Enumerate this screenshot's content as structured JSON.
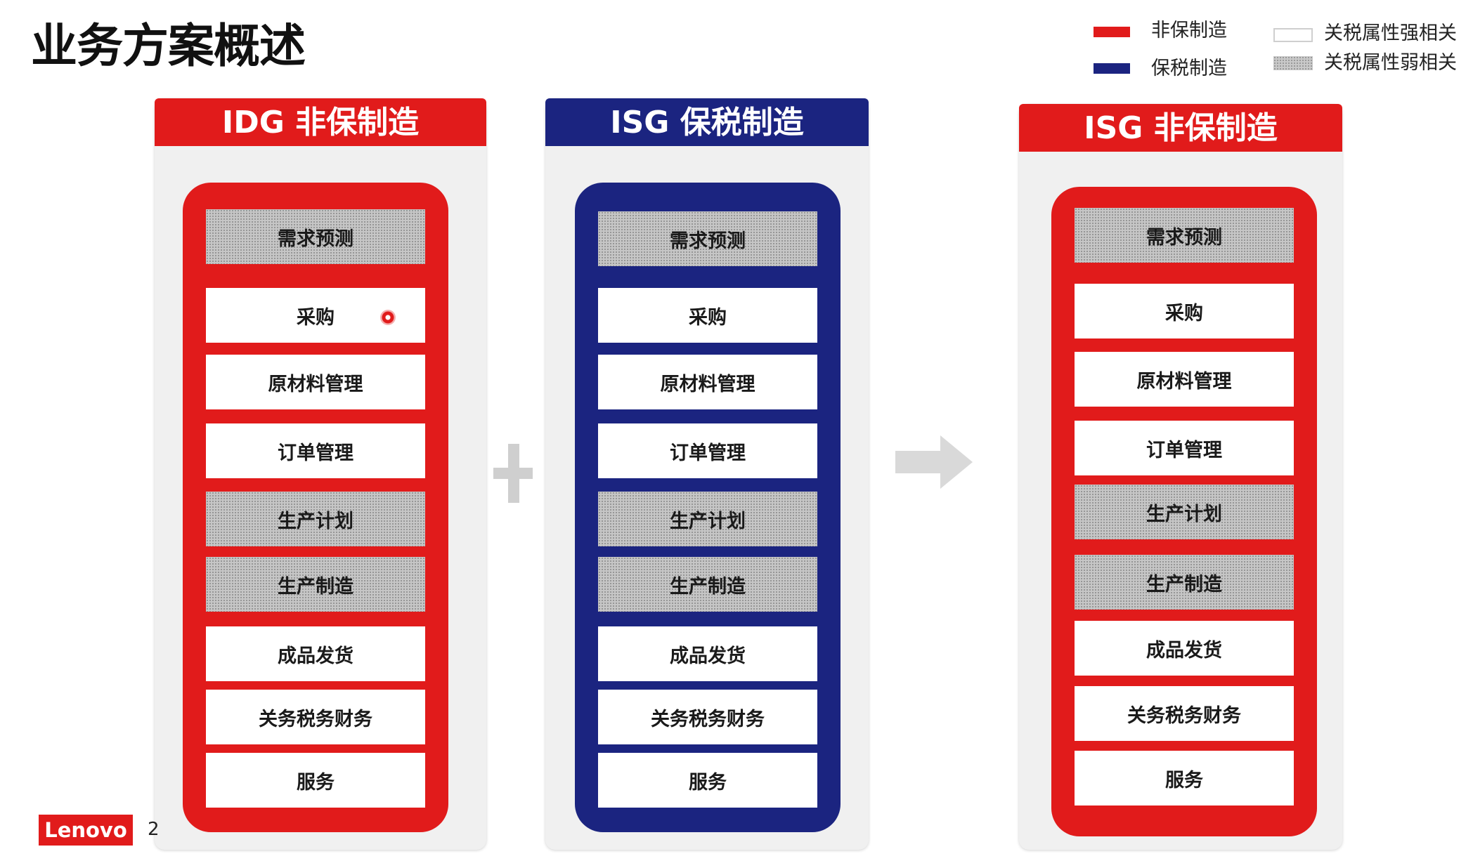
{
  "title": "业务方案概述",
  "colors": {
    "red": "#e11b1b",
    "navy": "#1b2480",
    "panel_bg": "#f0f0f0",
    "strong_fill": "#ffffff",
    "weak_fill": "dotted-gray"
  },
  "legend": {
    "items": [
      {
        "label": "非保制造",
        "swatch": "red"
      },
      {
        "label": "保税制造",
        "swatch": "navy"
      },
      {
        "label": "关税属性强相关",
        "swatch": "white-outline"
      },
      {
        "label": "关税属性弱相关",
        "swatch": "dotted-gray"
      }
    ]
  },
  "panels": [
    {
      "title": "IDG 非保制造",
      "color": "red",
      "steps": [
        {
          "label": "需求预测",
          "tariff": "weak"
        },
        {
          "label": "采购",
          "tariff": "strong"
        },
        {
          "label": "原材料管理",
          "tariff": "strong"
        },
        {
          "label": "订单管理",
          "tariff": "strong"
        },
        {
          "label": "生产计划",
          "tariff": "weak"
        },
        {
          "label": "生产制造",
          "tariff": "weak"
        },
        {
          "label": "成品发货",
          "tariff": "strong"
        },
        {
          "label": "关务税务财务",
          "tariff": "strong"
        },
        {
          "label": "服务",
          "tariff": "strong"
        }
      ]
    },
    {
      "title": "ISG 保税制造",
      "color": "navy",
      "steps": [
        {
          "label": "需求预测",
          "tariff": "weak"
        },
        {
          "label": "采购",
          "tariff": "strong"
        },
        {
          "label": "原材料管理",
          "tariff": "strong"
        },
        {
          "label": "订单管理",
          "tariff": "strong"
        },
        {
          "label": "生产计划",
          "tariff": "weak"
        },
        {
          "label": "生产制造",
          "tariff": "weak"
        },
        {
          "label": "成品发货",
          "tariff": "strong"
        },
        {
          "label": "关务税务财务",
          "tariff": "strong"
        },
        {
          "label": "服务",
          "tariff": "strong"
        }
      ]
    },
    {
      "title": "ISG 非保制造",
      "color": "red",
      "steps": [
        {
          "label": "需求预测",
          "tariff": "weak"
        },
        {
          "label": "采购",
          "tariff": "strong"
        },
        {
          "label": "原材料管理",
          "tariff": "strong"
        },
        {
          "label": "订单管理",
          "tariff": "strong"
        },
        {
          "label": "生产计划",
          "tariff": "weak"
        },
        {
          "label": "生产制造",
          "tariff": "weak"
        },
        {
          "label": "成品发货",
          "tariff": "strong"
        },
        {
          "label": "关务税务财务",
          "tariff": "strong"
        },
        {
          "label": "服务",
          "tariff": "strong"
        }
      ]
    }
  ],
  "operators": {
    "plus": "plus-icon",
    "arrow": "arrow-right-icon"
  },
  "footer": {
    "logo_text": "Lenovo",
    "page_number": "2"
  }
}
